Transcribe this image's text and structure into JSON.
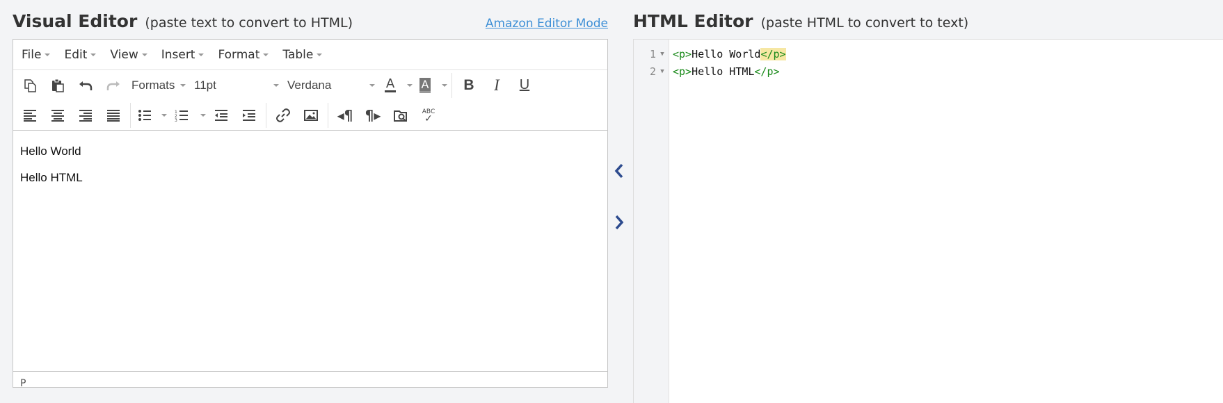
{
  "visual_editor": {
    "title": "Visual Editor",
    "subtitle": "(paste text to convert to HTML)",
    "amazon_link": "Amazon Editor Mode",
    "menu": [
      "File",
      "Edit",
      "View",
      "Insert",
      "Format",
      "Table"
    ],
    "toolbar": {
      "formats_label": "Formats",
      "font_size": "11pt",
      "font_family": "Verdana",
      "text_color_glyph": "A",
      "bg_color_glyph": "A",
      "bold_glyph": "B",
      "italic_glyph": "I",
      "underline_glyph": "U",
      "spellcheck_label": "ABC"
    },
    "content": [
      "Hello World",
      "Hello HTML"
    ],
    "status_path": "P"
  },
  "html_editor": {
    "title": "HTML Editor",
    "subtitle": "(paste HTML to convert to text)",
    "lines": [
      {
        "number": "1",
        "open_tag": "<p>",
        "text": "Hello World",
        "close_tag": "</p>"
      },
      {
        "number": "2",
        "open_tag": "<p>",
        "text": "Hello HTML",
        "close_tag": "</p>"
      }
    ]
  },
  "colors": {
    "link": "#3d8fd6",
    "tag": "#1a8a1a",
    "arrow": "#2d4b8e",
    "highlight": "#f6e7a3"
  }
}
